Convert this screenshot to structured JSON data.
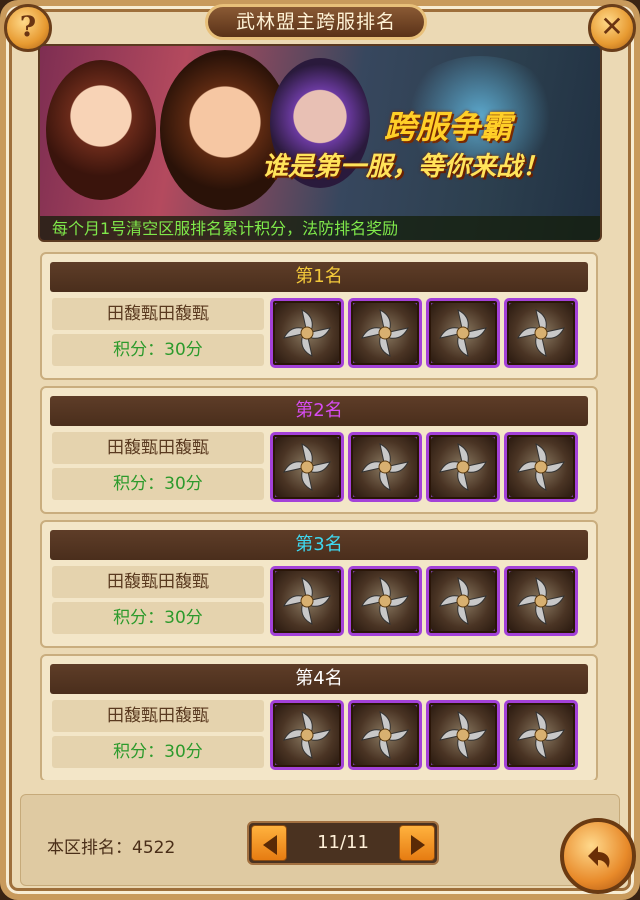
{
  "window": {
    "title": "武林盟主跨服排名"
  },
  "buttons": {
    "help": "?",
    "close": "✕"
  },
  "banner": {
    "slogan_main": "跨服争霸",
    "slogan_sub": "谁是第一服，等你来战！",
    "note": "每个月1号清空区服排名累计积分，法防排名奖励"
  },
  "ranks": [
    {
      "title": "第1名",
      "title_color": "#f2c83a",
      "name": "田馥甄田馥甄",
      "score": "积分：30分",
      "rewards": [
        "shuriken-icon",
        "shuriken-icon",
        "shuriken-icon",
        "shuriken-icon"
      ]
    },
    {
      "title": "第2名",
      "title_color": "#d64cf0",
      "name": "田馥甄田馥甄",
      "score": "积分：30分",
      "rewards": [
        "shuriken-icon",
        "shuriken-icon",
        "shuriken-icon",
        "shuriken-icon"
      ]
    },
    {
      "title": "第3名",
      "title_color": "#3fd8f0",
      "name": "田馥甄田馥甄",
      "score": "积分：30分",
      "rewards": [
        "shuriken-icon",
        "shuriken-icon",
        "shuriken-icon",
        "shuriken-icon"
      ]
    },
    {
      "title": "第4名",
      "title_color": "#ffffff",
      "name": "田馥甄田馥甄",
      "score": "积分：30分",
      "rewards": [
        "shuriken-icon",
        "shuriken-icon",
        "shuriken-icon",
        "shuriken-icon"
      ]
    }
  ],
  "footer": {
    "region_rank": "本区排名：4522",
    "page": "11/11"
  }
}
